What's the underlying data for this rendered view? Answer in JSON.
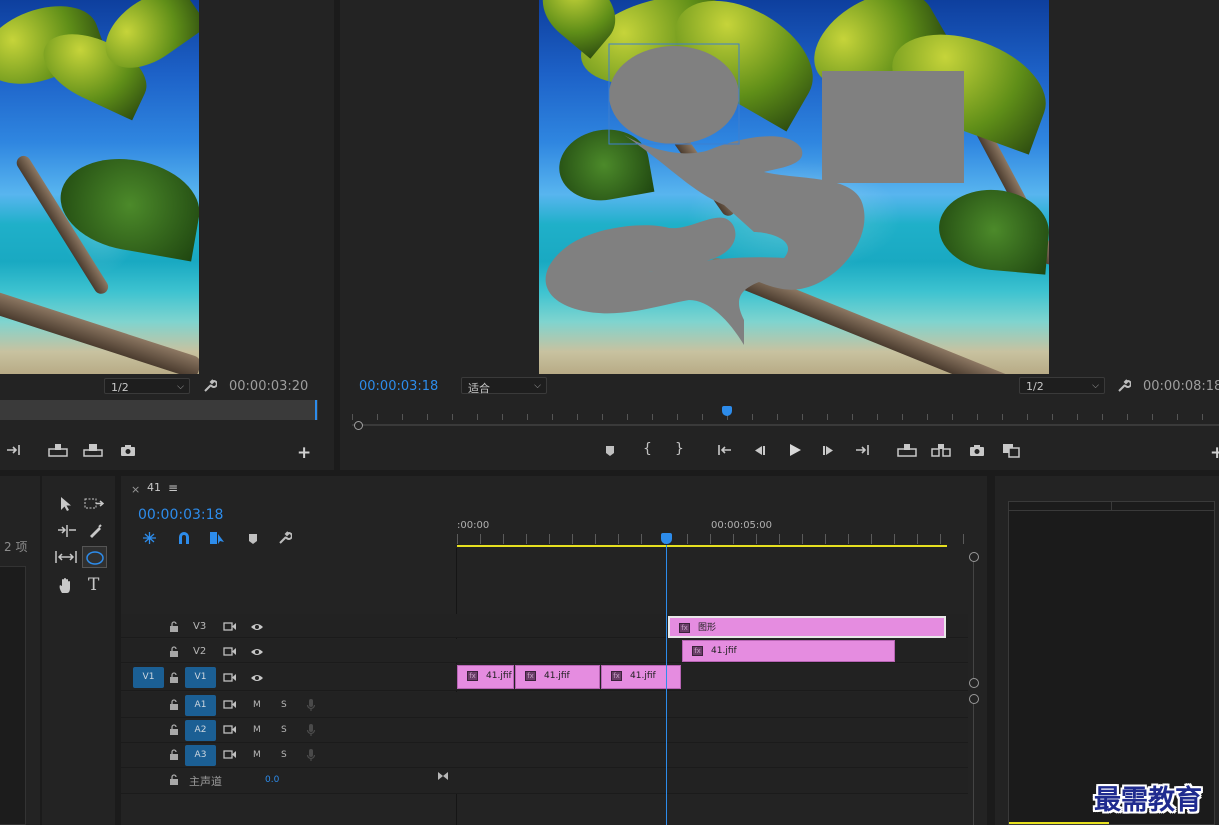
{
  "source_monitor": {
    "resolution": "1/2",
    "timecode": "00:00:03:20"
  },
  "program_monitor": {
    "current_time": "00:00:03:18",
    "zoom": "适合",
    "resolution": "1/2",
    "duration": "00:00:08:18"
  },
  "project_panel": {
    "item_count": "2 项"
  },
  "timeline": {
    "tab_close": "×",
    "sequence_name": "41",
    "menu_icon": "≡",
    "current_time": "00:00:03:18",
    "ruler_start": ":00:00",
    "ruler_mid": "00:00:05:00",
    "playhead_time_fraction": 0.41,
    "tracks": {
      "v3": "V3",
      "v2": "V2",
      "v1": "V1",
      "v1_source": "V1",
      "a1": "A1",
      "a2": "A2",
      "a3": "A3",
      "mute": "M",
      "solo": "S",
      "master": "主声道",
      "master_volume": "0.0"
    },
    "clips": {
      "graphic": "图形",
      "v2_clip": "41.jfif",
      "v1_clip_1": "41.jfif",
      "v1_clip_2": "41.jfif",
      "v1_clip_3": "41.jfif",
      "fx": "fx"
    }
  },
  "watermark": "最需教育",
  "colors": {
    "accent_blue": "#2d8ceb",
    "clip_pink": "#e58ce0",
    "work_area_yellow": "#e6e020",
    "track_target_blue": "#1b5f94",
    "shape_gray": "#808080"
  },
  "icons": [
    "wrench-icon",
    "play-icon",
    "step-back-icon",
    "step-forward-icon",
    "go-to-in-icon",
    "go-to-out-icon",
    "mark-in-icon",
    "mark-out-icon",
    "add-marker-icon",
    "lift-icon",
    "extract-icon",
    "export-frame-icon",
    "compare-icon",
    "button-editor-plus-icon",
    "selection-tool-icon",
    "track-select-icon",
    "ripple-edit-icon",
    "razor-tool-icon",
    "slip-tool-icon",
    "ellipse-tool-icon",
    "hand-tool-icon",
    "type-tool-icon",
    "snap-icon",
    "linked-selection-icon",
    "nest-icon",
    "timeline-marker-icon",
    "timeline-settings-icon",
    "lock-icon",
    "toggle-sync-icon",
    "eye-icon",
    "microphone-icon"
  ]
}
